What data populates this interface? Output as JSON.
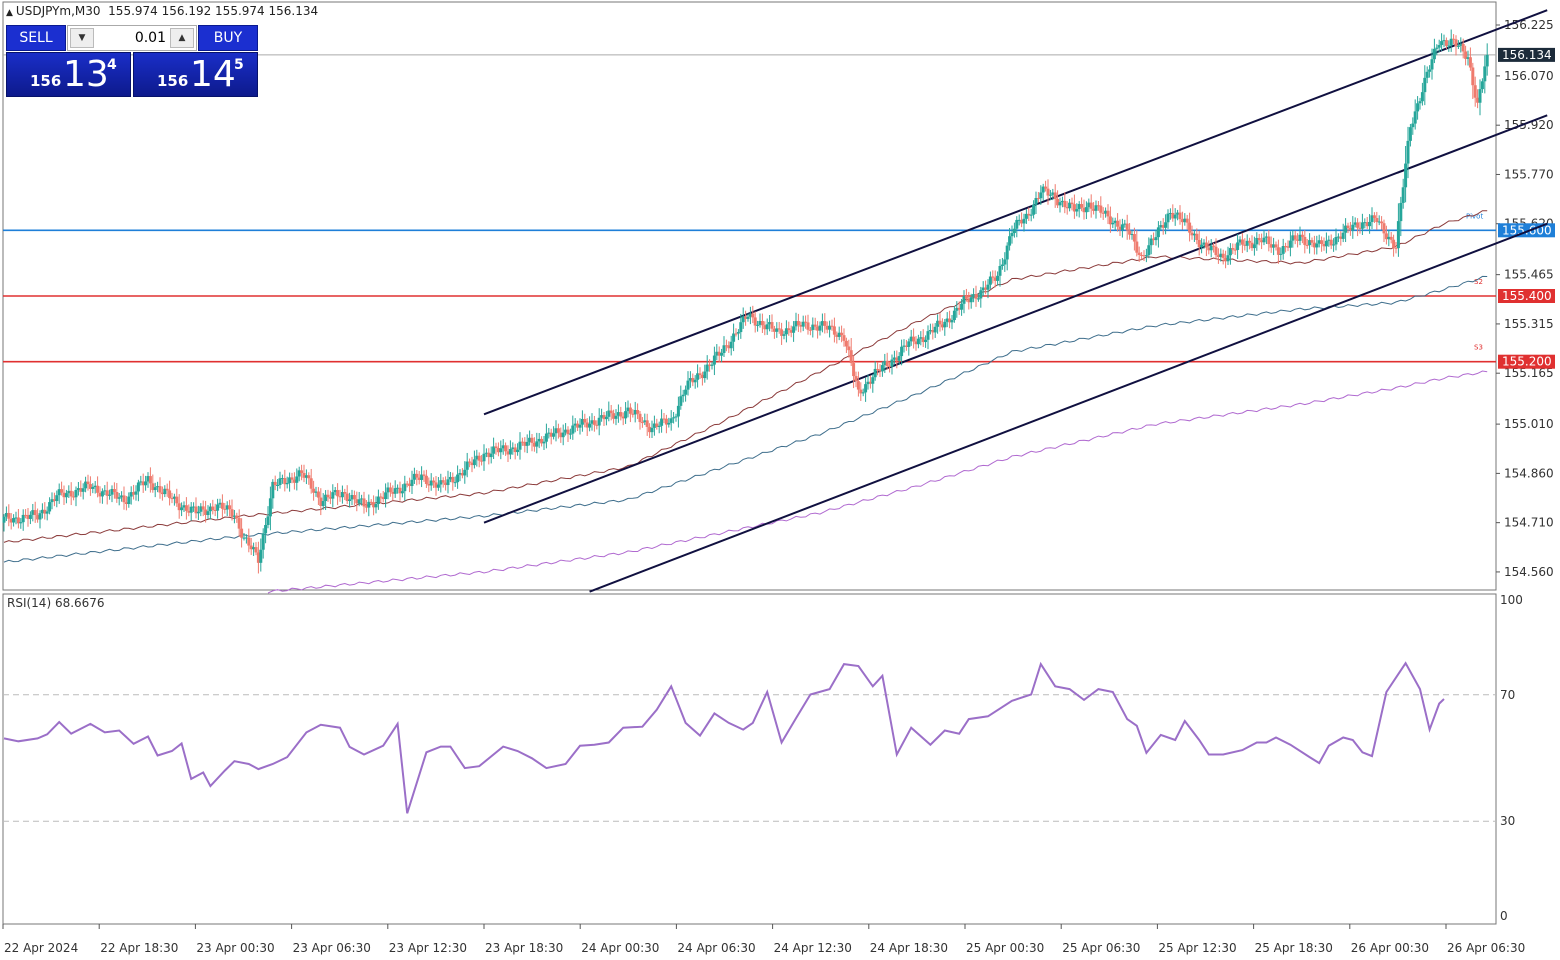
{
  "header": {
    "symbol_line": "USDJPYm,M30",
    "ohlc": "155.974 156.192 155.974 156.134"
  },
  "trade_panel": {
    "sell_label": "SELL",
    "buy_label": "BUY",
    "lot": "0.01",
    "sell_price": {
      "prefix": "156",
      "big": "13",
      "sup": "4"
    },
    "buy_price": {
      "prefix": "156",
      "big": "14",
      "sup": "5"
    }
  },
  "colors": {
    "bull": "#26a69a",
    "bear": "#ef7a6d",
    "ma_fast": "#8b3a3a",
    "ma_mid": "#3e6e8c",
    "ma_slow": "#b06ad0",
    "rsi": "#9b6fc8",
    "channel": "#101040",
    "pivot": "#1e7fd8",
    "support": "#e03030"
  },
  "chart_data": {
    "type": "candlestick",
    "price_axis": {
      "ticks": [
        "156.225",
        "156.070",
        "155.920",
        "155.770",
        "155.620",
        "155.465",
        "155.315",
        "155.165",
        "155.010",
        "154.860",
        "154.710",
        "154.560"
      ],
      "ylim": [
        154.505,
        156.295
      ]
    },
    "time_axis": {
      "labels": [
        "22 Apr 2024",
        "22 Apr 18:30",
        "23 Apr 00:30",
        "23 Apr 06:30",
        "23 Apr 12:30",
        "23 Apr 18:30",
        "24 Apr 00:30",
        "24 Apr 06:30",
        "24 Apr 12:30",
        "24 Apr 18:30",
        "25 Apr 00:30",
        "25 Apr 06:30",
        "25 Apr 12:30",
        "25 Apr 18:30",
        "26 Apr 00:30",
        "26 Apr 06:30"
      ]
    },
    "current_price": {
      "value": 156.134,
      "label": "156.134"
    },
    "levels": [
      {
        "name": "Pivot",
        "value": 155.6,
        "label": "155.600",
        "tag": "Pivot",
        "kind": "pivot"
      },
      {
        "name": "S2",
        "value": 155.4,
        "label": "155.400",
        "tag": "S2",
        "kind": "support"
      },
      {
        "name": "S3",
        "value": 155.2,
        "label": "155.200",
        "tag": "S3",
        "kind": "support"
      }
    ],
    "close_path": [
      [
        0,
        154.72
      ],
      [
        14,
        154.73
      ],
      [
        22,
        154.79
      ],
      [
        36,
        154.82
      ],
      [
        50,
        154.78
      ],
      [
        60,
        154.84
      ],
      [
        72,
        154.77
      ],
      [
        80,
        154.74
      ],
      [
        88,
        154.76
      ],
      [
        96,
        154.74
      ],
      [
        100,
        154.66
      ],
      [
        106,
        154.6
      ],
      [
        112,
        154.82
      ],
      [
        124,
        154.86
      ],
      [
        132,
        154.78
      ],
      [
        142,
        154.8
      ],
      [
        150,
        154.76
      ],
      [
        158,
        154.79
      ],
      [
        166,
        154.82
      ],
      [
        174,
        154.85
      ],
      [
        182,
        154.82
      ],
      [
        190,
        154.86
      ],
      [
        200,
        154.92
      ],
      [
        214,
        154.94
      ],
      [
        230,
        154.98
      ],
      [
        246,
        155.02
      ],
      [
        260,
        155.05
      ],
      [
        270,
        155.0
      ],
      [
        278,
        155.02
      ],
      [
        284,
        155.12
      ],
      [
        298,
        155.22
      ],
      [
        310,
        155.34
      ],
      [
        322,
        155.29
      ],
      [
        332,
        155.31
      ],
      [
        340,
        155.31
      ],
      [
        350,
        155.28
      ],
      [
        356,
        155.1
      ],
      [
        362,
        155.16
      ],
      [
        368,
        155.19
      ],
      [
        376,
        155.25
      ],
      [
        384,
        155.28
      ],
      [
        392,
        155.32
      ],
      [
        400,
        155.38
      ],
      [
        408,
        155.42
      ],
      [
        414,
        155.46
      ],
      [
        420,
        155.6
      ],
      [
        426,
        155.64
      ],
      [
        432,
        155.72
      ],
      [
        438,
        155.7
      ],
      [
        446,
        155.66
      ],
      [
        452,
        155.68
      ],
      [
        460,
        155.64
      ],
      [
        468,
        155.6
      ],
      [
        474,
        155.52
      ],
      [
        480,
        155.58
      ],
      [
        486,
        155.66
      ],
      [
        492,
        155.62
      ],
      [
        500,
        155.55
      ],
      [
        508,
        155.52
      ],
      [
        516,
        155.56
      ],
      [
        524,
        155.57
      ],
      [
        532,
        155.54
      ],
      [
        540,
        155.58
      ],
      [
        548,
        155.55
      ],
      [
        556,
        155.58
      ],
      [
        564,
        155.62
      ],
      [
        572,
        155.63
      ],
      [
        580,
        155.55
      ],
      [
        586,
        155.92
      ],
      [
        592,
        156.05
      ],
      [
        598,
        156.18
      ],
      [
        604,
        156.17
      ],
      [
        610,
        156.13
      ],
      [
        614,
        155.98
      ],
      [
        618,
        156.134
      ]
    ],
    "moving_averages": [
      {
        "id": "ma_fast",
        "points": [
          [
            0,
            154.65
          ],
          [
            100,
            154.73
          ],
          [
            200,
            154.8
          ],
          [
            260,
            154.88
          ],
          [
            300,
            155.02
          ],
          [
            340,
            155.17
          ],
          [
            380,
            155.32
          ],
          [
            420,
            155.45
          ],
          [
            480,
            155.52
          ],
          [
            540,
            155.5
          ],
          [
            580,
            155.55
          ],
          [
            600,
            155.62
          ],
          [
            618,
            155.66
          ]
        ]
      },
      {
        "id": "ma_mid",
        "points": [
          [
            0,
            154.59
          ],
          [
            100,
            154.67
          ],
          [
            200,
            154.73
          ],
          [
            260,
            154.78
          ],
          [
            300,
            154.88
          ],
          [
            340,
            154.98
          ],
          [
            380,
            155.1
          ],
          [
            420,
            155.23
          ],
          [
            480,
            155.31
          ],
          [
            540,
            155.36
          ],
          [
            580,
            155.38
          ],
          [
            600,
            155.42
          ],
          [
            618,
            155.46
          ]
        ]
      },
      {
        "id": "ma_slow",
        "points": [
          [
            110,
            154.5
          ],
          [
            200,
            154.56
          ],
          [
            260,
            154.62
          ],
          [
            300,
            154.68
          ],
          [
            340,
            154.74
          ],
          [
            380,
            154.82
          ],
          [
            420,
            154.91
          ],
          [
            480,
            155.01
          ],
          [
            540,
            155.07
          ],
          [
            580,
            155.12
          ],
          [
            600,
            155.15
          ],
          [
            618,
            155.17
          ]
        ]
      }
    ],
    "channel": {
      "lines": [
        {
          "from": [
            200,
            155.04
          ],
          "to": [
            643,
            156.27
          ]
        },
        {
          "from": [
            200,
            154.71
          ],
          "to": [
            643,
            155.95
          ]
        },
        {
          "from": [
            244,
            154.5
          ],
          "to": [
            643,
            155.62
          ]
        }
      ]
    },
    "rsi": {
      "label": "RSI(14) 68.6676",
      "ticks": [
        "100",
        "70",
        "30",
        "0"
      ],
      "levels": [
        70,
        30
      ],
      "points": [
        [
          0,
          56.2
        ],
        [
          6,
          55.3
        ],
        [
          14,
          56.2
        ],
        [
          18,
          57.5
        ],
        [
          23,
          61.4
        ],
        [
          28,
          57.7
        ],
        [
          36,
          60.8
        ],
        [
          42,
          58.1
        ],
        [
          48,
          58.7
        ],
        [
          54,
          54.5
        ],
        [
          60,
          56.8
        ],
        [
          64,
          50.8
        ],
        [
          70,
          52.2
        ],
        [
          74,
          54.6
        ],
        [
          78,
          43.4
        ],
        [
          83,
          45.4
        ],
        [
          86,
          41.1
        ],
        [
          92,
          46.0
        ],
        [
          96,
          49.0
        ],
        [
          102,
          48.1
        ],
        [
          106,
          46.5
        ],
        [
          112,
          48.1
        ],
        [
          118,
          50.3
        ],
        [
          126,
          58.1
        ],
        [
          132,
          60.5
        ],
        [
          140,
          59.6
        ],
        [
          144,
          53.5
        ],
        [
          150,
          51.1
        ],
        [
          158,
          53.9
        ],
        [
          164,
          60.8
        ],
        [
          168,
          32.5
        ],
        [
          176,
          51.8
        ],
        [
          182,
          53.6
        ],
        [
          186,
          53.6
        ],
        [
          192,
          46.8
        ],
        [
          198,
          47.4
        ],
        [
          208,
          53.6
        ],
        [
          214,
          52.2
        ],
        [
          220,
          49.9
        ],
        [
          226,
          46.8
        ],
        [
          234,
          48.1
        ],
        [
          240,
          53.9
        ],
        [
          246,
          54.2
        ],
        [
          252,
          54.9
        ],
        [
          258,
          59.6
        ],
        [
          266,
          59.9
        ],
        [
          272,
          65.3
        ],
        [
          278,
          72.7
        ],
        [
          284,
          61.1
        ],
        [
          290,
          57.1
        ],
        [
          296,
          64.1
        ],
        [
          302,
          61.1
        ],
        [
          308,
          59.0
        ],
        [
          312,
          61.1
        ],
        [
          318,
          70.9
        ],
        [
          324,
          54.9
        ],
        [
          330,
          62.6
        ],
        [
          336,
          70.1
        ],
        [
          344,
          71.8
        ],
        [
          350,
          79.7
        ],
        [
          356,
          79.1
        ],
        [
          362,
          72.7
        ],
        [
          366,
          76.0
        ],
        [
          372,
          51.1
        ],
        [
          378,
          59.6
        ],
        [
          386,
          54.2
        ],
        [
          392,
          58.7
        ],
        [
          398,
          57.7
        ],
        [
          402,
          62.3
        ],
        [
          410,
          63.2
        ],
        [
          420,
          68.1
        ],
        [
          428,
          70.1
        ],
        [
          432,
          79.7
        ],
        [
          438,
          72.7
        ],
        [
          444,
          71.8
        ],
        [
          450,
          68.4
        ],
        [
          456,
          71.8
        ],
        [
          462,
          70.9
        ],
        [
          468,
          62.3
        ],
        [
          472,
          60.2
        ],
        [
          476,
          51.6
        ],
        [
          482,
          57.3
        ],
        [
          488,
          55.7
        ],
        [
          492,
          61.7
        ],
        [
          498,
          55.7
        ],
        [
          502,
          51.1
        ],
        [
          508,
          51.1
        ],
        [
          516,
          52.5
        ],
        [
          522,
          54.9
        ],
        [
          526,
          54.9
        ],
        [
          530,
          56.5
        ],
        [
          536,
          54.2
        ],
        [
          544,
          50.3
        ],
        [
          548,
          48.4
        ],
        [
          552,
          53.9
        ],
        [
          558,
          56.5
        ],
        [
          562,
          55.7
        ],
        [
          566,
          51.8
        ],
        [
          570,
          50.6
        ],
        [
          576,
          70.9
        ],
        [
          584,
          80.0
        ],
        [
          590,
          71.8
        ],
        [
          594,
          59.0
        ],
        [
          598,
          67.2
        ],
        [
          600,
          68.67
        ]
      ]
    }
  }
}
